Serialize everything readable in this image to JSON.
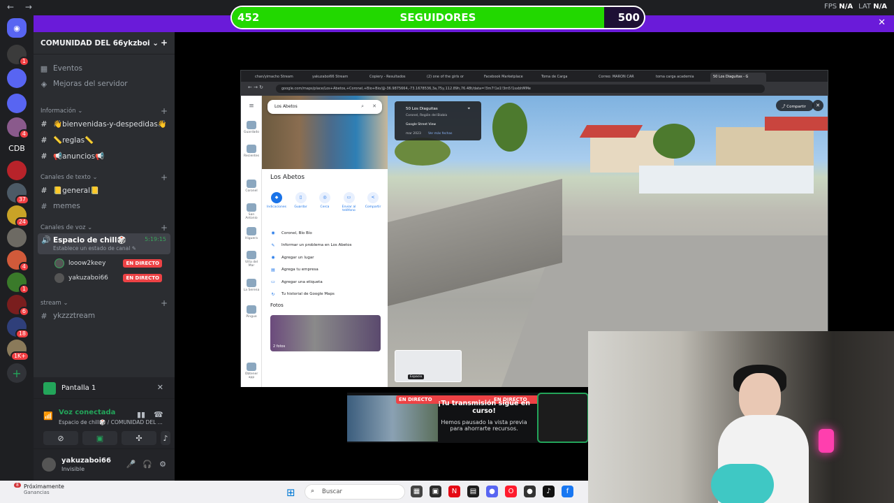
{
  "topbar": {
    "back": "←",
    "forward": "→",
    "fps_label": "FPS",
    "fps_value": "N/A",
    "lat_label": "LAT",
    "lat_value": "N/A"
  },
  "goal": {
    "current": "452",
    "label": "SEGUIDORES",
    "max": "500",
    "progress": 0.904,
    "close": "✕"
  },
  "rail": {
    "servers": [
      {
        "label": "",
        "badge": "1",
        "color": "#3b3b3b"
      },
      {
        "label": "",
        "badge": "",
        "color": "#5865f2"
      },
      {
        "label": "",
        "badge": "",
        "color": "#5865f2"
      },
      {
        "label": "",
        "badge": "4",
        "color": "#8a5a8c"
      },
      {
        "label": "CDB",
        "badge": "",
        "color": "#1e1f22"
      },
      {
        "label": "",
        "badge": "",
        "color": "#b8232a"
      },
      {
        "label": "",
        "badge": "37",
        "color": "#4c5a66"
      },
      {
        "label": "",
        "badge": "24",
        "color": "#c9a327"
      },
      {
        "label": "",
        "badge": "",
        "color": "#6d6a63"
      },
      {
        "label": "",
        "badge": "4",
        "color": "#d15a3a"
      },
      {
        "label": "",
        "badge": "1",
        "color": "#3a7a2a"
      },
      {
        "label": "",
        "badge": "6",
        "color": "#7a1e1e"
      },
      {
        "label": "",
        "badge": "18",
        "color": "#2f3f7a"
      },
      {
        "label": "",
        "badge": "1K+",
        "color": "#8a7a5a"
      }
    ],
    "add": "+"
  },
  "sidebar": {
    "server_name": "COMUNIDAD DEL 66ykzboi",
    "chevron": "⌄",
    "add_member": "+",
    "events": "Eventos",
    "boost": "Mejoras del servidor",
    "cat_info": "Información",
    "channels_info": [
      {
        "label": "👋bienvenidas-y-despedidas👋"
      },
      {
        "label": "📏reglas📏"
      },
      {
        "label": "📢anuncios📢"
      }
    ],
    "cat_text": "Canales de texto",
    "channels_text": [
      {
        "label": "📒general📒"
      },
      {
        "label": "memes"
      }
    ],
    "cat_voice": "Canales de voz",
    "voice_channel": {
      "name": "Espacio de chill🎲",
      "status": "Establece un estado de canal ✎",
      "time": "5:19:15"
    },
    "voice_users": [
      {
        "name": "looow2keey",
        "live": "EN DIRECTO"
      },
      {
        "name": "yakuzaboi66",
        "live": "EN DIRECTO"
      }
    ],
    "cat_stream": "stream",
    "channel_stream": "ykzzztream",
    "hash": "#",
    "plus": "+"
  },
  "share_panel": {
    "title": "Pantalla 1",
    "close": "✕"
  },
  "voice_panel": {
    "status": "Voz conectada",
    "location": "Espacio de chill🎲 / COMUNIDAD DEL ..."
  },
  "user_panel": {
    "name": "yakuzaboi66",
    "status": "Invisible"
  },
  "browser": {
    "tabs": [
      "chan/yimacho Stream",
      "yakuzaboi66 Stream",
      "Copiery - Resultados",
      "(2) one of the girls or",
      "Facebook Marketplace",
      "Toma de Carga",
      "Correo: MARON CAR",
      "toma carga academia",
      "50 Los Diaguitas - G"
    ],
    "url": "google.com/maps/place/Los+Abetos,+Coronel,+Bio+Bio/@-36.9875664,-73.1678536,3a,75y,112.89h,76.48t/data=!3m7!1e1!3m5!1sxbhMMe",
    "maps": {
      "search_value": "Los Abetos",
      "place_title": "Los Abetos",
      "actions": [
        {
          "label": "Indicaciones",
          "icon": "◆"
        },
        {
          "label": "Guardar",
          "icon": "▯"
        },
        {
          "label": "Cerca",
          "icon": "◎"
        },
        {
          "label": "Enviar al teléfono",
          "icon": "▭"
        },
        {
          "label": "Compartir",
          "icon": "<"
        }
      ],
      "info_rows": [
        {
          "icon": "◉",
          "label": "Coronel, Bío Bío"
        },
        {
          "icon": "✎",
          "label": "Informar un problema en Los Abetos"
        },
        {
          "icon": "◉",
          "label": "Agregar un lugar"
        },
        {
          "icon": "▤",
          "label": "Agrega tu empresa"
        },
        {
          "icon": "▭",
          "label": "Agregar una etiqueta"
        },
        {
          "icon": "↻",
          "label": "Tu historial de Google Maps"
        }
      ],
      "photos_heading": "Fotos",
      "photos_count": "2 fotos",
      "rail": [
        {
          "label": "Guardado"
        },
        {
          "label": "Recientes"
        },
        {
          "label": "Coronel"
        },
        {
          "label": "San Antonio"
        },
        {
          "label": "Higuera"
        },
        {
          "label": "Viña del Mar"
        },
        {
          "label": "La Serena"
        },
        {
          "label": "Pingue"
        },
        {
          "label": "Obtener app"
        }
      ]
    },
    "streetview": {
      "address": "50 Los Diaguitas",
      "region": "Coronel, Región del Biobío",
      "source": "Google Street View",
      "date": "mar 2023",
      "more_dates": "Ver más fechas",
      "share": "Compartir",
      "close": "✕",
      "minimap_label": "Espacio"
    }
  },
  "preview": {
    "live_badge": "EN DIRECTO",
    "title": "¡Tu transmisión sigue en curso!",
    "subtitle": "Hemos pausado la vista previa para ahorrarte recursos."
  },
  "taskbar": {
    "news_count": "8",
    "news_title": "Próximamente",
    "news_sub": "Ganancias",
    "search_placeholder": "Buscar",
    "apps": [
      {
        "icon": "▦",
        "color": "#444"
      },
      {
        "icon": "▣",
        "color": "#2b2b2b"
      },
      {
        "icon": "N",
        "color": "#e50914"
      },
      {
        "icon": "▤",
        "color": "#1e1e1e"
      },
      {
        "icon": "●",
        "color": "#5865f2"
      },
      {
        "icon": "O",
        "color": "#ff1b2d"
      },
      {
        "icon": "●",
        "color": "#333"
      },
      {
        "icon": "♪",
        "color": "#111"
      },
      {
        "icon": "f",
        "color": "#1877f2"
      }
    ]
  }
}
